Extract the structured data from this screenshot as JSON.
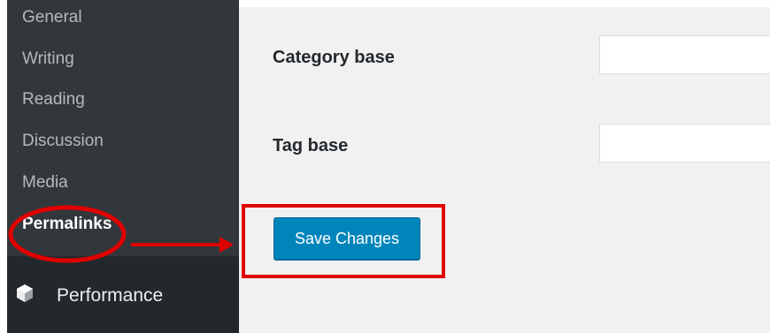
{
  "sidebar": {
    "items": [
      {
        "label": "General"
      },
      {
        "label": "Writing"
      },
      {
        "label": "Reading"
      },
      {
        "label": "Discussion"
      },
      {
        "label": "Media"
      },
      {
        "label": "Permalinks",
        "current": true
      }
    ],
    "performance": {
      "label": "Performance",
      "icon": "performance-icon"
    }
  },
  "form": {
    "category_base": {
      "label": "Category base",
      "value": ""
    },
    "tag_base": {
      "label": "Tag base",
      "value": ""
    },
    "save_label": "Save Changes"
  },
  "annotations": {
    "highlight_color": "#e00000"
  },
  "colors": {
    "sidebar_bg": "#23282d",
    "submenu_bg": "#32373c",
    "content_bg": "#f1f1f1",
    "button_bg": "#0085ba"
  }
}
